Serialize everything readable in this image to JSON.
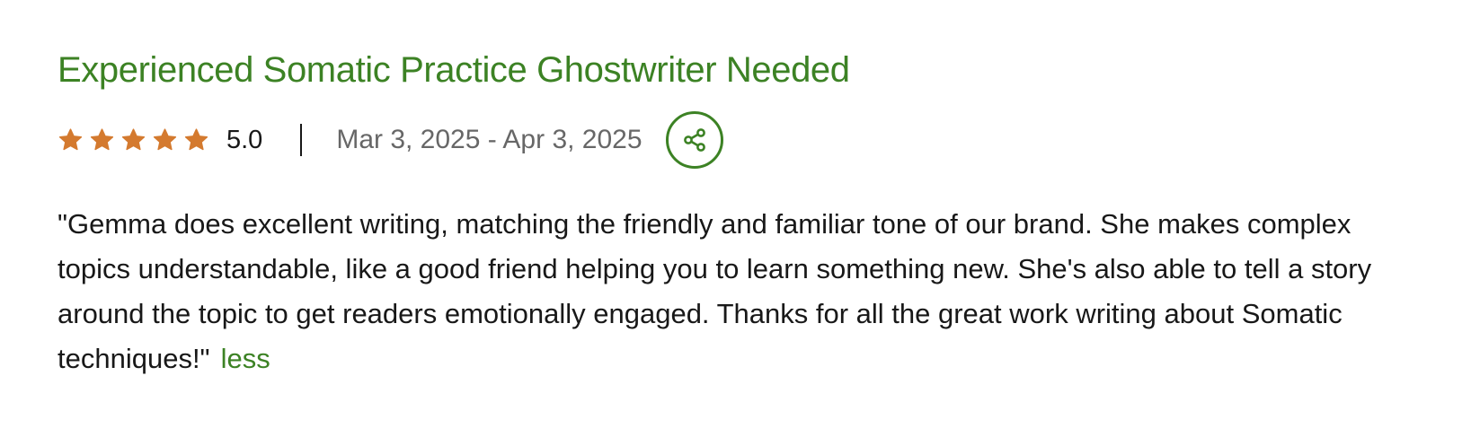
{
  "colors": {
    "accent": "#3c8224",
    "star": "#d47a2f",
    "muted_text": "#676767",
    "body_text": "#181818"
  },
  "job": {
    "title": "Experienced Somatic Practice Ghostwriter Needed",
    "rating": {
      "stars_filled": 5,
      "stars_total": 5,
      "value": "5.0"
    },
    "date_range": "Mar 3, 2025 - Apr 3, 2025",
    "share_icon": "share-icon"
  },
  "review": {
    "text": "\"Gemma does excellent writing, matching the friendly and familiar tone of our brand. She makes complex topics understandable, like a good friend helping you to learn something new. She's also able to tell a story around the topic to get readers emotionally engaged. Thanks for all the great work writing about Somatic techniques!\"",
    "toggle_label": "less"
  }
}
